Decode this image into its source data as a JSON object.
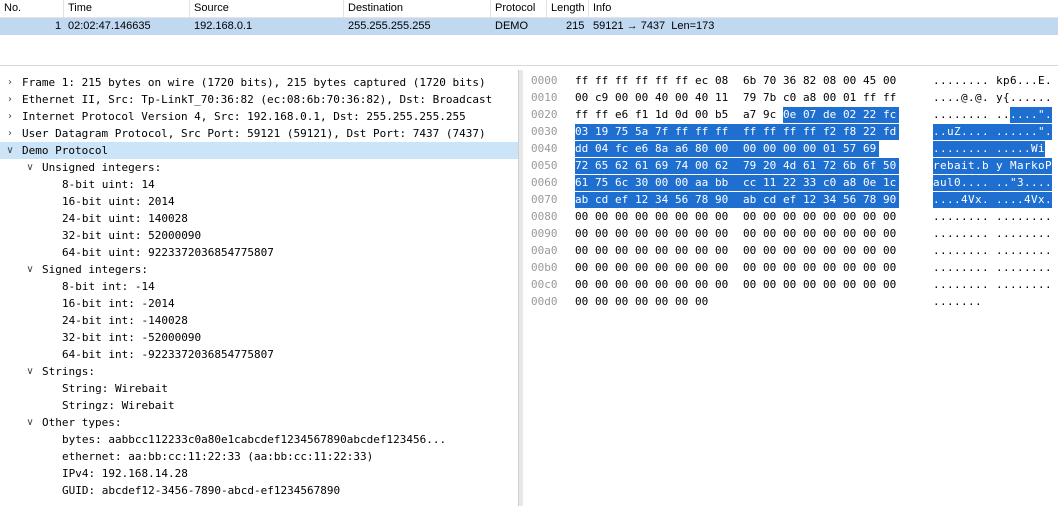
{
  "packet_list": {
    "headers": [
      "No.",
      "Time",
      "Source",
      "Destination",
      "Protocol",
      "Length",
      "Info"
    ],
    "rows": [
      {
        "no": "1",
        "time": "02:02:47.146635",
        "source": "192.168.0.1",
        "destination": "255.255.255.255",
        "protocol": "DEMO",
        "length": "215",
        "info": "59121 → 7437  Len=173"
      }
    ]
  },
  "details": [
    {
      "label": "Frame 1: 215 bytes on wire (1720 bits), 215 bytes captured (1720 bits)",
      "level": 0,
      "arrow": "collapsed"
    },
    {
      "label": "Ethernet II, Src: Tp-LinkT_70:36:82 (ec:08:6b:70:36:82), Dst: Broadcast",
      "level": 0,
      "arrow": "collapsed"
    },
    {
      "label": "Internet Protocol Version 4, Src: 192.168.0.1, Dst: 255.255.255.255",
      "level": 0,
      "arrow": "collapsed"
    },
    {
      "label": "User Datagram Protocol, Src Port: 59121 (59121), Dst Port: 7437 (7437)",
      "level": 0,
      "arrow": "collapsed"
    },
    {
      "label": "Demo Protocol",
      "level": 0,
      "arrow": "expanded",
      "selected": true
    },
    {
      "label": "Unsigned integers:",
      "level": 1,
      "arrow": "expanded"
    },
    {
      "label": "8-bit uint: 14",
      "level": 2
    },
    {
      "label": "16-bit uint: 2014",
      "level": 2
    },
    {
      "label": "24-bit uint: 140028",
      "level": 2
    },
    {
      "label": "32-bit uint: 52000090",
      "level": 2
    },
    {
      "label": "64-bit uint: 9223372036854775807",
      "level": 2
    },
    {
      "label": "Signed integers:",
      "level": 1,
      "arrow": "expanded"
    },
    {
      "label": "8-bit int: -14",
      "level": 2
    },
    {
      "label": "16-bit int: -2014",
      "level": 2
    },
    {
      "label": "24-bit int: -140028",
      "level": 2
    },
    {
      "label": "32-bit int: -52000090",
      "level": 2
    },
    {
      "label": "64-bit int: -9223372036854775807",
      "level": 2
    },
    {
      "label": "Strings:",
      "level": 1,
      "arrow": "expanded"
    },
    {
      "label": "String: Wirebait",
      "level": 2
    },
    {
      "label": "Stringz: Wirebait",
      "level": 2
    },
    {
      "label": "Other types:",
      "level": 1,
      "arrow": "expanded"
    },
    {
      "label": "bytes: aabbcc112233c0a80e1cabcdef1234567890abcdef123456...",
      "level": 2
    },
    {
      "label": "ethernet: aa:bb:cc:11:22:33 (aa:bb:cc:11:22:33)",
      "level": 2
    },
    {
      "label": "IPv4: 192.168.14.28",
      "level": 2
    },
    {
      "label": "GUID: abcdef12-3456-7890-abcd-ef1234567890",
      "level": 2
    }
  ],
  "bytes": [
    {
      "offset": "0000",
      "hex": [
        "ff",
        "ff",
        "ff",
        "ff",
        "ff",
        "ff",
        "ec",
        "08",
        "6b",
        "70",
        "36",
        "82",
        "08",
        "00",
        "45",
        "00"
      ],
      "ascii": "........ kp6...E.",
      "hl_start": 16
    },
    {
      "offset": "0010",
      "hex": [
        "00",
        "c9",
        "00",
        "00",
        "40",
        "00",
        "40",
        "11",
        "79",
        "7b",
        "c0",
        "a8",
        "00",
        "01",
        "ff",
        "ff"
      ],
      "ascii": "....@.@. y{......",
      "hl_start": 16
    },
    {
      "offset": "0020",
      "hex": [
        "ff",
        "ff",
        "e6",
        "f1",
        "1d",
        "0d",
        "00",
        "b5",
        "a7",
        "9c",
        "0e",
        "07",
        "de",
        "02",
        "22",
        "fc"
      ],
      "ascii": "........ ......\".",
      "hl_start": 10
    },
    {
      "offset": "0030",
      "hex": [
        "03",
        "19",
        "75",
        "5a",
        "7f",
        "ff",
        "ff",
        "ff",
        "ff",
        "ff",
        "ff",
        "ff",
        "f2",
        "f8",
        "22",
        "fd"
      ],
      "ascii": "..uZ.... ......\".",
      "hl_start": 0
    },
    {
      "offset": "0040",
      "hex": [
        "dd",
        "04",
        "fc",
        "e6",
        "8a",
        "a6",
        "80",
        "00",
        "00",
        "00",
        "00",
        "00",
        "01",
        "57",
        "69"
      ],
      "ascii": "........ .....Wi",
      "hl_start": 0
    },
    {
      "offset": "0050",
      "hex": [
        "72",
        "65",
        "62",
        "61",
        "69",
        "74",
        "00",
        "62",
        "79",
        "20",
        "4d",
        "61",
        "72",
        "6b",
        "6f",
        "50"
      ],
      "ascii": "rebait.b y MarkoP",
      "hl_start": 0
    },
    {
      "offset": "0060",
      "hex": [
        "61",
        "75",
        "6c",
        "30",
        "00",
        "00",
        "aa",
        "bb",
        "cc",
        "11",
        "22",
        "33",
        "c0",
        "a8",
        "0e",
        "1c"
      ],
      "ascii": "aul0.... ..\"3....",
      "hl_start": 0
    },
    {
      "offset": "0070",
      "hex": [
        "ab",
        "cd",
        "ef",
        "12",
        "34",
        "56",
        "78",
        "90",
        "ab",
        "cd",
        "ef",
        "12",
        "34",
        "56",
        "78",
        "90"
      ],
      "ascii": "....4Vx. ....4Vx.",
      "hl_start": 0
    },
    {
      "offset": "0080",
      "hex": [
        "00",
        "00",
        "00",
        "00",
        "00",
        "00",
        "00",
        "00",
        "00",
        "00",
        "00",
        "00",
        "00",
        "00",
        "00",
        "00"
      ],
      "ascii": "........ ........",
      "hl_start": 16
    },
    {
      "offset": "0090",
      "hex": [
        "00",
        "00",
        "00",
        "00",
        "00",
        "00",
        "00",
        "00",
        "00",
        "00",
        "00",
        "00",
        "00",
        "00",
        "00",
        "00"
      ],
      "ascii": "........ ........",
      "hl_start": 16
    },
    {
      "offset": "00a0",
      "hex": [
        "00",
        "00",
        "00",
        "00",
        "00",
        "00",
        "00",
        "00",
        "00",
        "00",
        "00",
        "00",
        "00",
        "00",
        "00",
        "00"
      ],
      "ascii": "........ ........",
      "hl_start": 16
    },
    {
      "offset": "00b0",
      "hex": [
        "00",
        "00",
        "00",
        "00",
        "00",
        "00",
        "00",
        "00",
        "00",
        "00",
        "00",
        "00",
        "00",
        "00",
        "00",
        "00"
      ],
      "ascii": "........ ........",
      "hl_start": 16
    },
    {
      "offset": "00c0",
      "hex": [
        "00",
        "00",
        "00",
        "00",
        "00",
        "00",
        "00",
        "00",
        "00",
        "00",
        "00",
        "00",
        "00",
        "00",
        "00",
        "00"
      ],
      "ascii": "........ ........",
      "hl_start": 16
    },
    {
      "offset": "00d0",
      "hex": [
        "00",
        "00",
        "00",
        "00",
        "00",
        "00",
        "00"
      ],
      "ascii": ".......",
      "hl_start": 16
    }
  ],
  "colors": {
    "selected_packet_row": "#c0d8f0",
    "selected_tree_row": "#cce4f7",
    "byte_highlight": "#1e6fd0"
  }
}
